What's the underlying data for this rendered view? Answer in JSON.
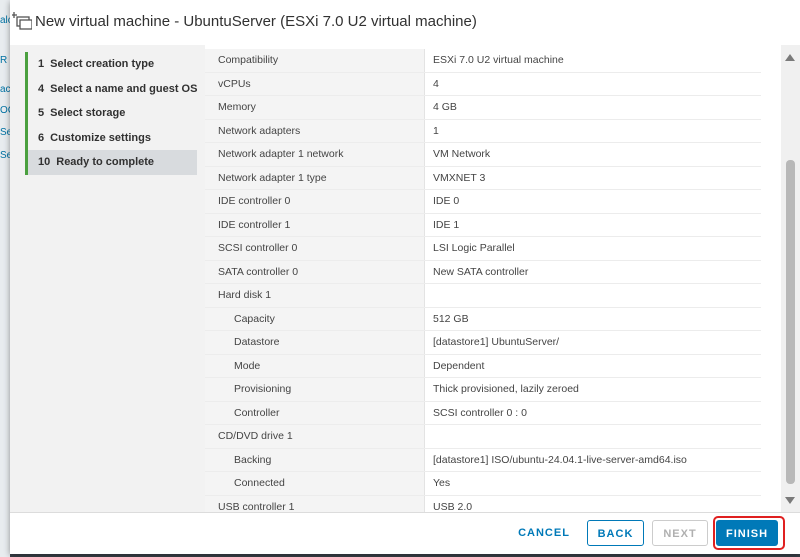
{
  "dialog": {
    "title": "New virtual machine - UbuntuServer (ESXi 7.0 U2 virtual machine)"
  },
  "background_fragments": [
    "alc",
    "R",
    "ac",
    "OC",
    "Se",
    "Se"
  ],
  "steps": [
    {
      "num": "1",
      "label": "Select creation type"
    },
    {
      "num": "4",
      "label": "Select a name and guest OS"
    },
    {
      "num": "5",
      "label": "Select storage"
    },
    {
      "num": "6",
      "label": "Customize settings"
    },
    {
      "num": "10",
      "label": "Ready to complete"
    }
  ],
  "summary": [
    {
      "label": "Compatibility",
      "value": "ESXi 7.0 U2 virtual machine",
      "sub": false
    },
    {
      "label": "vCPUs",
      "value": "4",
      "sub": false
    },
    {
      "label": "Memory",
      "value": "4 GB",
      "sub": false
    },
    {
      "label": "Network adapters",
      "value": "1",
      "sub": false
    },
    {
      "label": "Network adapter 1 network",
      "value": "VM Network",
      "sub": false
    },
    {
      "label": "Network adapter 1 type",
      "value": "VMXNET 3",
      "sub": false
    },
    {
      "label": "IDE controller 0",
      "value": "IDE 0",
      "sub": false
    },
    {
      "label": "IDE controller 1",
      "value": "IDE 1",
      "sub": false
    },
    {
      "label": "SCSI controller 0",
      "value": "LSI Logic Parallel",
      "sub": false
    },
    {
      "label": "SATA controller 0",
      "value": "New SATA controller",
      "sub": false
    },
    {
      "label": "Hard disk 1",
      "value": "",
      "sub": false
    },
    {
      "label": "Capacity",
      "value": "512 GB",
      "sub": true
    },
    {
      "label": "Datastore",
      "value": "[datastore1] UbuntuServer/",
      "sub": true
    },
    {
      "label": "Mode",
      "value": "Dependent",
      "sub": true
    },
    {
      "label": "Provisioning",
      "value": "Thick provisioned, lazily zeroed",
      "sub": true
    },
    {
      "label": "Controller",
      "value": "SCSI controller 0 : 0",
      "sub": true
    },
    {
      "label": "CD/DVD drive 1",
      "value": "",
      "sub": false
    },
    {
      "label": "Backing",
      "value": "[datastore1] ISO/ubuntu-24.04.1-live-server-amd64.iso",
      "sub": true
    },
    {
      "label": "Connected",
      "value": "Yes",
      "sub": true
    },
    {
      "label": "USB controller 1",
      "value": "USB 2.0",
      "sub": false
    }
  ],
  "footer": {
    "cancel": "CANCEL",
    "back": "BACK",
    "next": "NEXT",
    "finish": "FINISH"
  },
  "colors": {
    "accent": "#0079b8",
    "step_bar": "#4ba03f",
    "highlight": "#e02020"
  }
}
